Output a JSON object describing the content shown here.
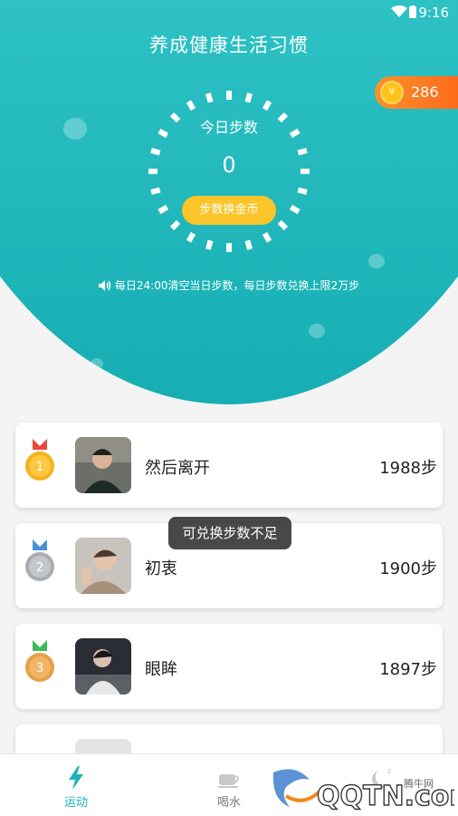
{
  "status_bar": {
    "time": "9:16"
  },
  "header": {
    "title": "养成健康生活习惯",
    "coin_count": "286",
    "coin_symbol": "¥"
  },
  "pedometer": {
    "label": "今日步数",
    "count": "0",
    "exchange_button": "步数换金币",
    "notice": "每日24:00清空当日步数，每日步数兑换上限2万步"
  },
  "ranking": [
    {
      "rank": "1",
      "name": "然后离开",
      "steps": "1988步",
      "medal_color": "#f6b21c",
      "ribbon_color": "#e8483b"
    },
    {
      "rank": "2",
      "name": "初衷",
      "steps": "1900步",
      "medal_color": "#b5b9bd",
      "ribbon_color": "#4a90d9"
    },
    {
      "rank": "3",
      "name": "眼眸",
      "steps": "1897步",
      "medal_color": "#e6a04a",
      "ribbon_color": "#3dbb5c"
    },
    {
      "rank": "4",
      "name": "",
      "steps": ""
    }
  ],
  "toast": "可兑换步数不足",
  "tab_bar": {
    "tabs": [
      {
        "label": "运动",
        "icon": "lightning-icon",
        "active": true
      },
      {
        "label": "喝水",
        "icon": "cup-icon",
        "active": false
      },
      {
        "label": "",
        "icon": "sleep-icon",
        "active": false
      }
    ]
  },
  "watermark": {
    "site": "腾牛网",
    "domain": "QQTN.com"
  },
  "colors": {
    "accent": "#1cb3bc",
    "hero_top": "#56d4d8",
    "hero_bottom": "#16aeb3",
    "button": "#fbc52a",
    "coin_badge": "#ff6a1a"
  }
}
